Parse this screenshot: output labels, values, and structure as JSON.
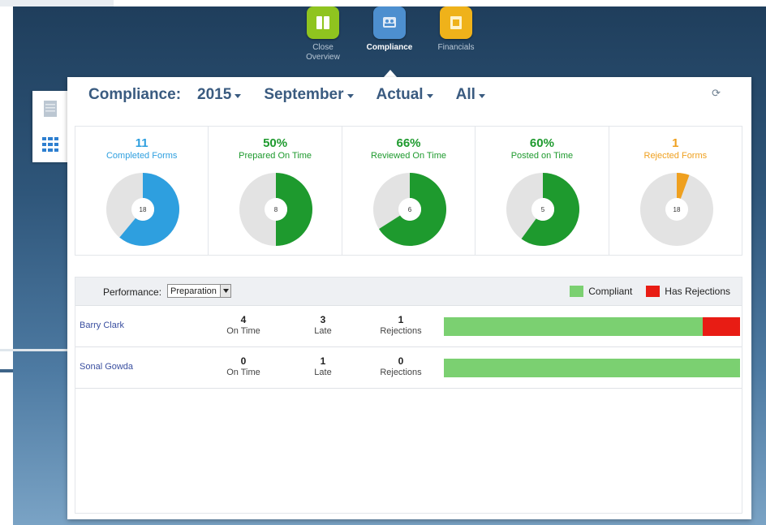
{
  "nav": [
    {
      "label_lines": [
        "Close",
        "Overview"
      ],
      "icon": "book-icon",
      "color": "#8fc41f",
      "active": false
    },
    {
      "label_lines": [
        "Compliance"
      ],
      "icon": "people-icon",
      "color": "#4d8fcf",
      "active": true
    },
    {
      "label_lines": [
        "Financials"
      ],
      "icon": "briefcase-icon",
      "color": "#efb21a",
      "active": false
    }
  ],
  "view_tabs": [
    "list-view-icon",
    "grid-view-icon"
  ],
  "header": {
    "title": "Compliance:",
    "year": "2015",
    "month": "September",
    "scenario": "Actual",
    "filter": "All"
  },
  "metrics": [
    {
      "value": "11",
      "label": "Completed Forms",
      "color": "#2e9fdf",
      "center": "18",
      "fraction": 0.61
    },
    {
      "value": "50%",
      "label": "Prepared On Time",
      "color": "#1e9a2e",
      "center": "8",
      "fraction": 0.5
    },
    {
      "value": "66%",
      "label": "Reviewed On Time",
      "color": "#1e9a2e",
      "center": "6",
      "fraction": 0.66
    },
    {
      "value": "60%",
      "label": "Posted on Time",
      "color": "#1e9a2e",
      "center": "5",
      "fraction": 0.6
    },
    {
      "value": "1",
      "label": "Rejected Forms",
      "color": "#efa01f",
      "center": "18",
      "fraction": 0.056
    }
  ],
  "performance": {
    "label": "Performance:",
    "selected": "Preparation",
    "legend": [
      {
        "label": "Compliant",
        "color": "#7bd071"
      },
      {
        "label": "Has Rejections",
        "color": "#e81c14"
      }
    ],
    "rows": [
      {
        "name": "Barry Clark",
        "on_time": "4",
        "on_time_label": "On Time",
        "late": "3",
        "late_label": "Late",
        "rejections": "1",
        "rejections_label": "Rejections",
        "compliant_fraction": 0.873,
        "rejection_fraction": 0.127
      },
      {
        "name": "Sonal Gowda",
        "on_time": "0",
        "on_time_label": "On Time",
        "late": "1",
        "late_label": "Late",
        "rejections": "0",
        "rejections_label": "Rejections",
        "compliant_fraction": 1.0,
        "rejection_fraction": 0.0
      }
    ]
  }
}
